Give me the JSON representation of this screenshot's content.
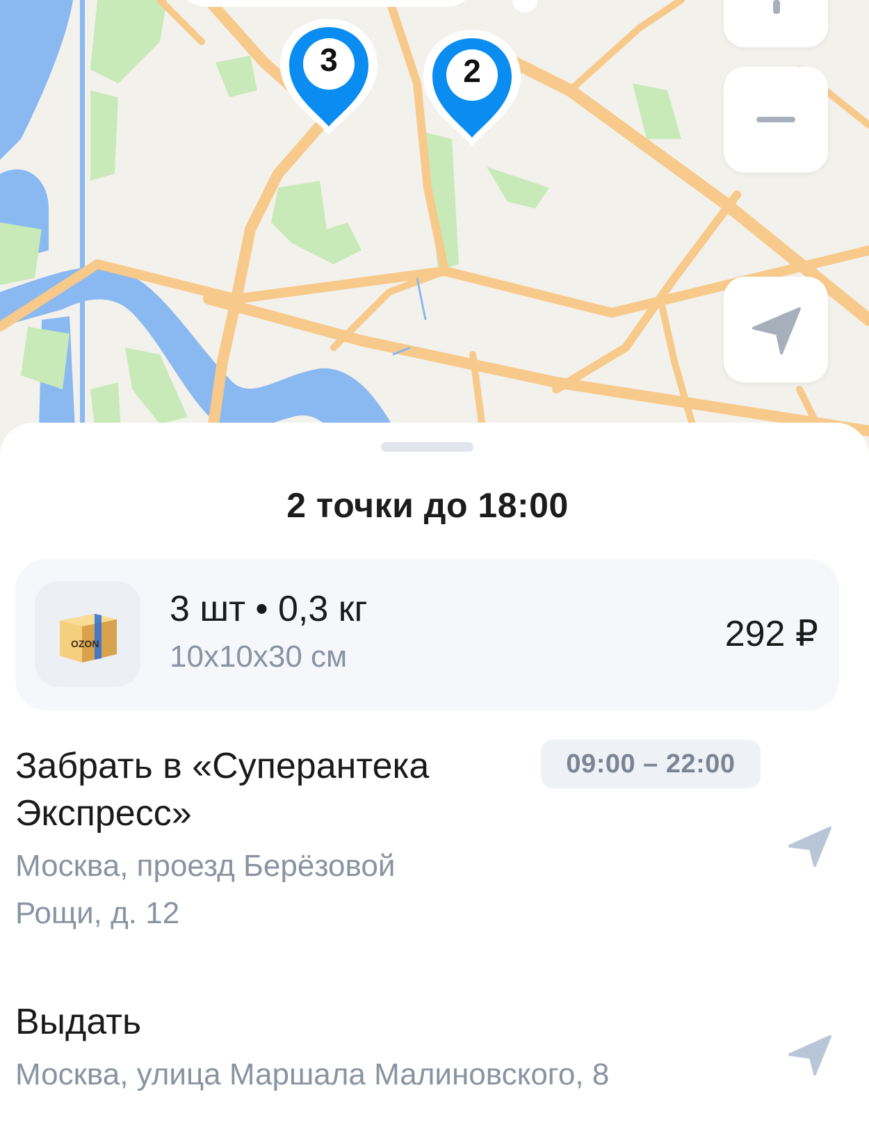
{
  "map": {
    "pins": [
      {
        "count": "3"
      },
      {
        "count": "2"
      }
    ],
    "icons": {
      "zoom_in": "plus-icon",
      "zoom_out": "minus-icon",
      "locate": "navigation-arrow-icon"
    },
    "colors": {
      "land": "#f3f1ec",
      "water": "#8ab8f0",
      "park": "#c8eab8",
      "road": "#f7c98a",
      "pin": "#0a8cf0"
    }
  },
  "sheet": {
    "title": "2 точки до 18:00"
  },
  "parcel": {
    "thumbnail_icon": "ozon-box-icon",
    "thumbnail_brand": "OZON",
    "quantity_weight": "3 шт • 0,3 кг",
    "dimensions": "10x10x30 см",
    "price": "292 ₽"
  },
  "stops": [
    {
      "title": "Забрать в «Суперантека Экспресс»",
      "address": "Москва, проезд Берёзовой Рощи, д. 12",
      "time_window": "09:00 – 22:00",
      "icon": "navigation-arrow-icon"
    },
    {
      "title": "Выдать",
      "address": "Москва, улица Маршала Малиновского, 8",
      "icon": "navigation-arrow-icon"
    }
  ]
}
